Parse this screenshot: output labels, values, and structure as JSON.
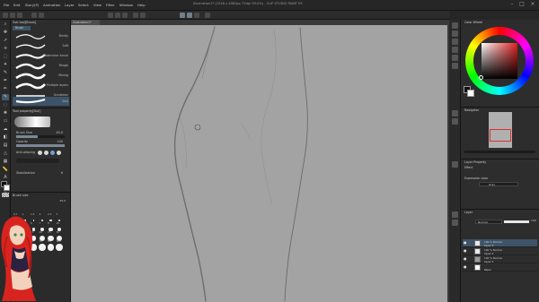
{
  "app": {
    "title": "Illustration1* (1018 x 4083px 72dpi 99.0%) - CLIP STUDIO PAINT EX",
    "menu": [
      "File",
      "Edit",
      "Story(P)",
      "Animation",
      "Layer",
      "Select",
      "View",
      "Filter",
      "Window",
      "Help"
    ]
  },
  "canvas": {
    "tab_label": "Illustration1*",
    "background_color": "#a3a3a3",
    "stroke_color": "#6a6a6a"
  },
  "subtool": {
    "tab_label": "Sub tool[Brush]",
    "group_label": "Brush",
    "brushes": [
      {
        "label": "Bristly",
        "selected": false
      },
      {
        "label": "Soft",
        "selected": false
      },
      {
        "label": "Watercolor brush",
        "selected": false
      },
      {
        "label": "Rough",
        "selected": false
      },
      {
        "label": "Mixing",
        "selected": false
      },
      {
        "label": "Multiple layers",
        "selected": false
      },
      {
        "label": "Gradation",
        "selected": false
      },
      {
        "label": "Dull",
        "selected": true
      }
    ]
  },
  "tool_property": {
    "tab_label": "Tool property[Dull]",
    "brush_size_label": "Brush Size",
    "brush_size_value": "45.0",
    "opacity_label": "Opacity",
    "opacity_value": "100",
    "anti_aliasing_label": "Anti-aliasing",
    "stabilization_label": "Stabilization",
    "stabilization_value": "6",
    "brush_size_fraction": 0.45,
    "opacity_fraction": 1.0
  },
  "brush_size_panel": {
    "tab_label": "Brush size",
    "current_value": "45.0",
    "sizes": [
      "0.7",
      "1",
      "1.5",
      "2",
      "2.5",
      "3",
      "4",
      "5",
      "6",
      "7",
      "8",
      "10",
      "12",
      "15",
      "17",
      "20",
      "25",
      "30",
      "40",
      "50",
      "60",
      "70",
      "80",
      "100"
    ]
  },
  "color_panel": {
    "tab_label": "Color Wheel",
    "main_color": "#111111",
    "sub_color": "#ffffff",
    "hue_color": "#e02020"
  },
  "navigator": {
    "tab_label": "Navigator"
  },
  "layer_property": {
    "tab_label": "Layer Property",
    "effect_label": "Effect",
    "expression_color_label": "Expression color",
    "expression_color_value": "Gray"
  },
  "layers": {
    "tab_label": "Layer",
    "blend_mode": "Normal",
    "opacity": "100",
    "items": [
      {
        "line1": "100 % Normal",
        "line2": "Layer 3",
        "selected": true
      },
      {
        "line1": "100 % Normal",
        "line2": "Layer 2",
        "selected": false
      },
      {
        "line1": "100 % Normal",
        "line2": "Layer 1",
        "selected": false
      },
      {
        "line1": "",
        "line2": "Paper",
        "selected": false
      }
    ]
  }
}
